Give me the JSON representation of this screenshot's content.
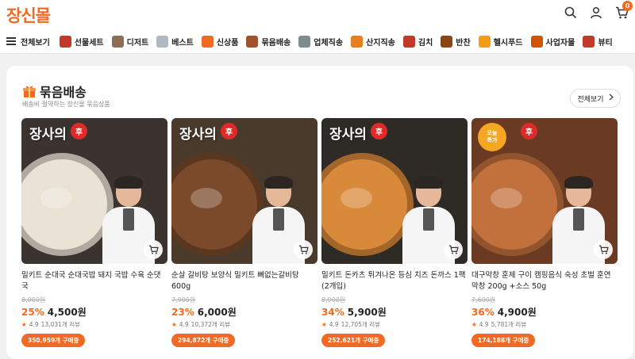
{
  "header": {
    "logo": "장신몰",
    "cart_count": "0",
    "icons": [
      "search-icon",
      "user-icon",
      "cart-icon"
    ]
  },
  "nav": {
    "all_label": "전체보기",
    "items": [
      {
        "label": "선물세트",
        "color": "#c0392b"
      },
      {
        "label": "디저트",
        "color": "#8e6e53"
      },
      {
        "label": "베스트",
        "color": "#b0b8c4"
      },
      {
        "label": "신상품",
        "color": "#f26a21"
      },
      {
        "label": "묶음배송",
        "color": "#a0522d"
      },
      {
        "label": "업체직송",
        "color": "#7f8c8d"
      },
      {
        "label": "산지직송",
        "color": "#e67e22"
      },
      {
        "label": "김치",
        "color": "#c0392b"
      },
      {
        "label": "반찬",
        "color": "#8b4513"
      },
      {
        "label": "헬시푸드",
        "color": "#f39c12"
      },
      {
        "label": "사업자몰",
        "color": "#d35400"
      },
      {
        "label": "뷰티",
        "color": "#c0392b"
      }
    ]
  },
  "section": {
    "title": "묶음배송",
    "subtitle": "배송비 절약하는 장신몰 묶음상품",
    "all_button": "전체보기"
  },
  "brand": {
    "mark": "장사의",
    "seal": "후"
  },
  "products": [
    {
      "name": "밀키트 순대국 순대국밥 돼지 국밥 수육 순댓국",
      "original_price": "8,000원",
      "discount": "25%",
      "price": "4,500원",
      "rating": "4.9",
      "reviews": "13,031개 리뷰",
      "sold": "350,959개 구매중",
      "bg": "#3a3330",
      "food": "#e9e3d6"
    },
    {
      "name": "순살 갈비탕 보양식 밀키트 뼈없는갈비탕 600g",
      "original_price": "7,900원",
      "discount": "23%",
      "price": "6,000원",
      "rating": "4.9",
      "reviews": "10,372개 리뷰",
      "sold": "294,872개 구매중",
      "bg": "#4a3a2c",
      "food": "#7a4a2a"
    },
    {
      "name": "밀키트 돈카츠 튀겨나온 등심 치즈 돈까스 1팩 (2개입)",
      "original_price": "8,900원",
      "discount": "34%",
      "price": "5,900원",
      "rating": "4.9",
      "reviews": "12,705개 리뷰",
      "sold": "252,621개 구매중",
      "bg": "#2e2a26",
      "food": "#d9893a"
    },
    {
      "name": "대구막창 훈제 구이 캠핑음식 숙성 초벌 훈연 막창 200g +소스 50g",
      "original_price": "7,600원",
      "discount": "36%",
      "price": "4,900원",
      "rating": "4.9",
      "reviews": "5,781개 리뷰",
      "sold": "174,188개 구매중",
      "bg": "#6a3a22",
      "food": "#c2713d",
      "special_line1": "오늘",
      "special_line2": "특가"
    }
  ]
}
